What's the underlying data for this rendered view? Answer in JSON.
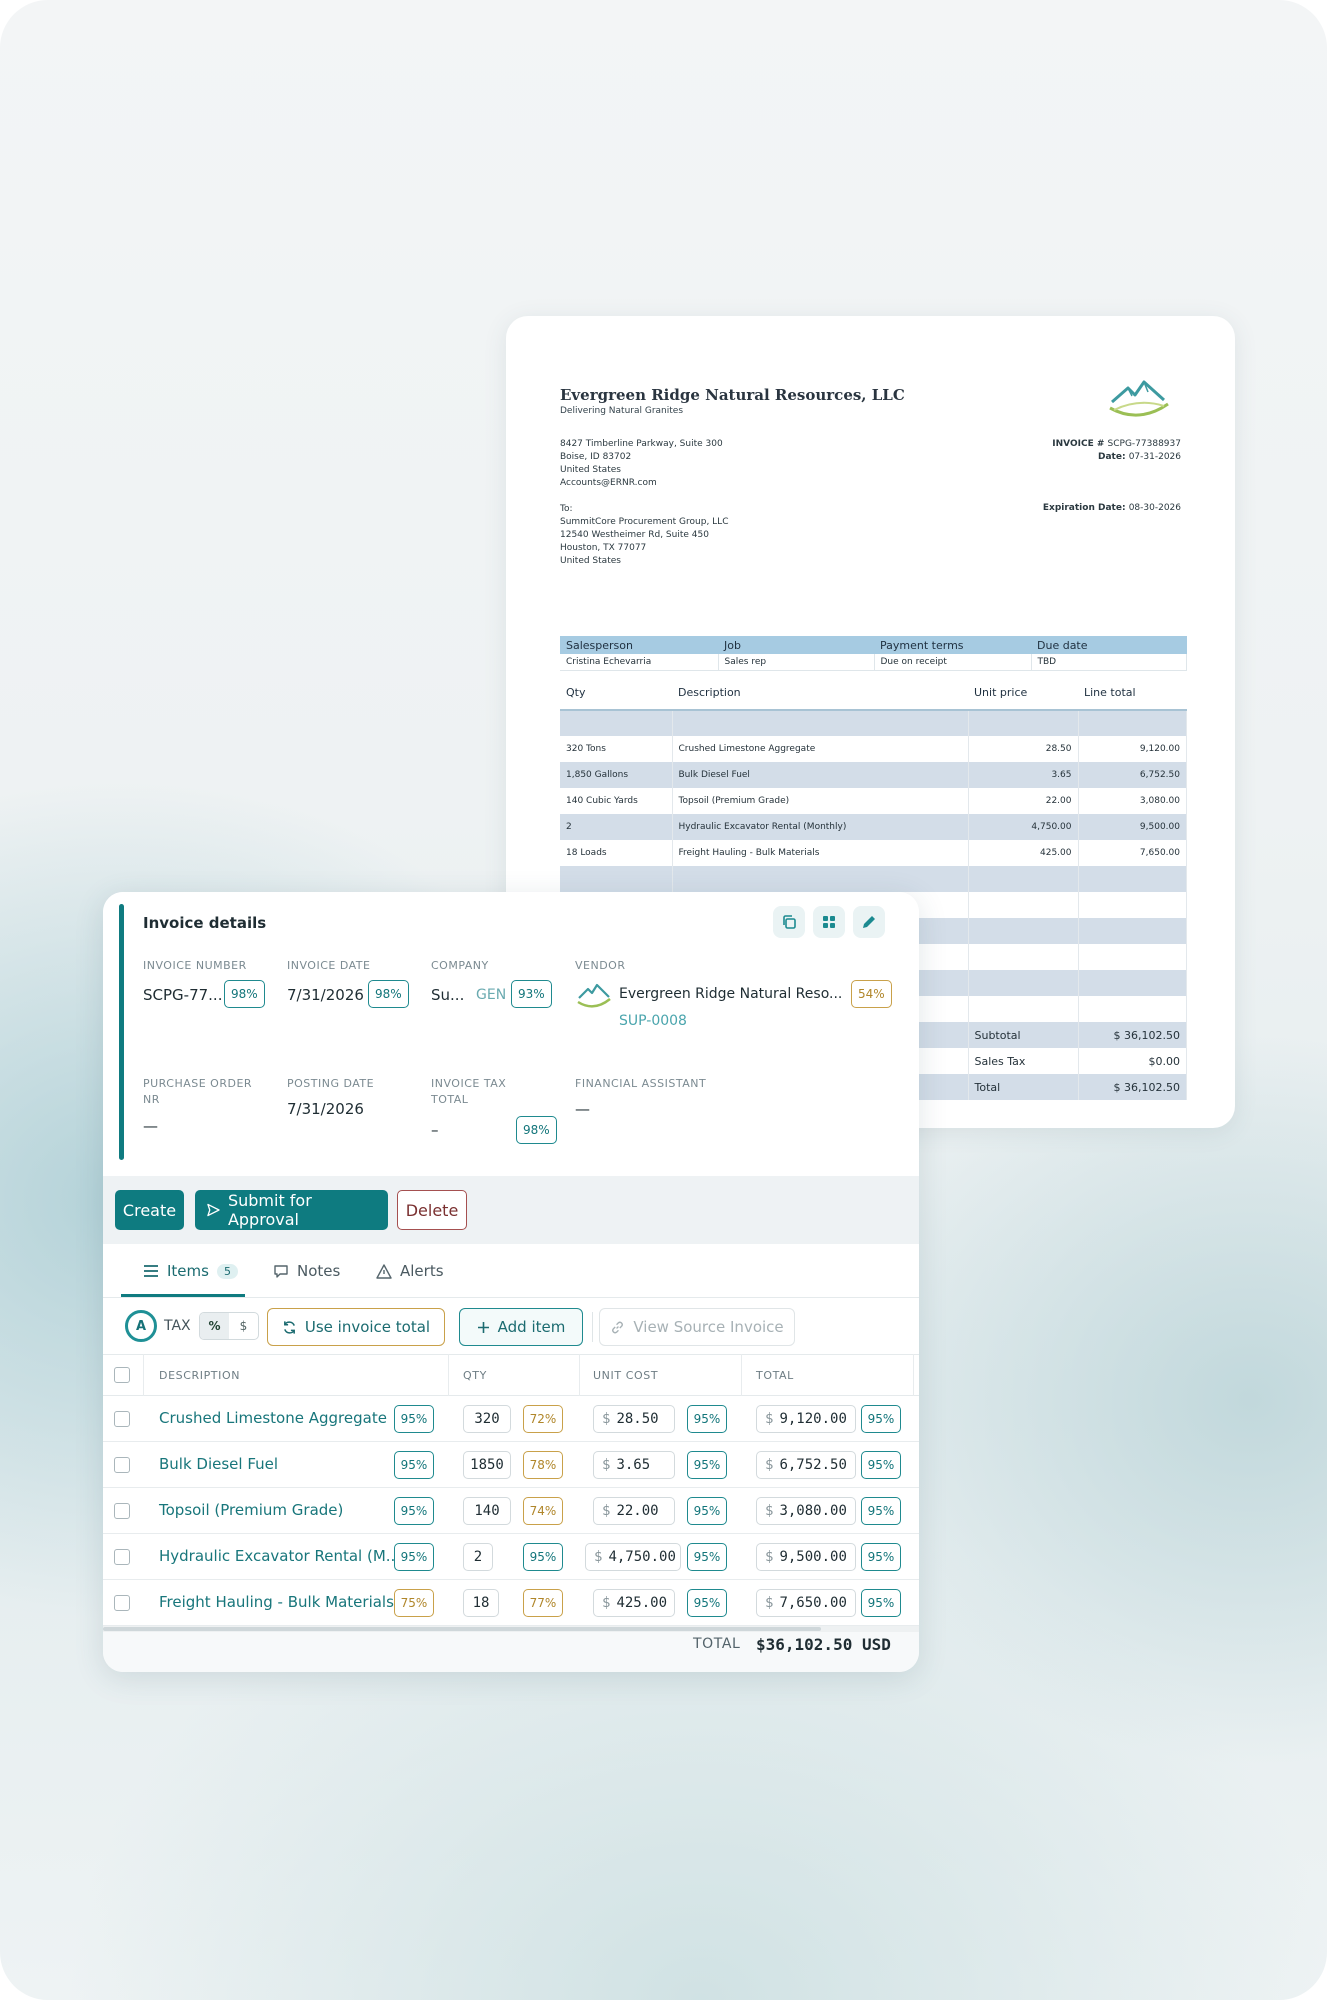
{
  "document": {
    "company_name": "Evergreen Ridge Natural Resources, LLC",
    "tagline": "Delivering Natural Granites",
    "address_lines": [
      "8427 Timberline Parkway, Suite 300",
      "Boise, ID 83702",
      "United States",
      "Accounts@ERNR.com"
    ],
    "invoice_number_label": "INVOICE # ",
    "invoice_number": "SCPG-77388937",
    "date_label": "Date: ",
    "date": "07-31-2026",
    "to_lines": [
      "To:",
      "SummitCore Procurement Group, LLC",
      "12540 Westheimer Rd, Suite 450",
      "Houston, TX 77077",
      "United States"
    ],
    "expiration_label": "Expiration Date: ",
    "expiration_date": "08-30-2026",
    "sales_headers": [
      "Salesperson",
      "Job",
      "Payment terms",
      "Due date"
    ],
    "sales_values": [
      "Cristina Echevarria",
      "Sales rep",
      "Due on receipt",
      "TBD"
    ],
    "line_headers": [
      "Qty",
      "Description",
      "Unit price",
      "Line total"
    ],
    "lines": [
      {
        "qty": "320 Tons",
        "desc": "Crushed Limestone Aggregate",
        "price": "28.50",
        "total": "9,120.00"
      },
      {
        "qty": "1,850 Gallons",
        "desc": "Bulk Diesel Fuel",
        "price": "3.65",
        "total": "6,752.50"
      },
      {
        "qty": "140 Cubic Yards",
        "desc": "Topsoil (Premium Grade)",
        "price": "22.00",
        "total": "3,080.00"
      },
      {
        "qty": "2",
        "desc": "Hydraulic Excavator Rental (Monthly)",
        "price": "4,750.00",
        "total": "9,500.00"
      },
      {
        "qty": "18 Loads",
        "desc": "Freight Hauling - Bulk Materials",
        "price": "425.00",
        "total": "7,650.00"
      }
    ],
    "subtotal_label": "Subtotal",
    "subtotal": "$ 36,102.50",
    "tax_label": "Sales Tax",
    "tax": "$0.00",
    "total_label": "Total",
    "total": "$ 36,102.50",
    "brand_color": "#4a9fa5"
  },
  "details": {
    "title": "Invoice details",
    "invoice_number": {
      "label": "INVOICE NUMBER",
      "value": "SCPG-77...",
      "confidence": "98%"
    },
    "invoice_date": {
      "label": "INVOICE DATE",
      "value": "7/31/2026",
      "confidence": "98%"
    },
    "company": {
      "label": "COMPANY",
      "value": "Su...",
      "code": "GEN",
      "confidence": "93%"
    },
    "vendor": {
      "label": "VENDOR",
      "value": "Evergreen Ridge Natural Reso...",
      "id": "SUP-0008",
      "confidence": "54%"
    },
    "purchase_order": {
      "label_1": "PURCHASE ORDER",
      "label_2": "NR",
      "value": "—"
    },
    "posting_date": {
      "label": "POSTING DATE",
      "value": "7/31/2026"
    },
    "tax_total": {
      "label_1": "INVOICE TAX",
      "label_2": "TOTAL",
      "value": "–",
      "confidence": "98%"
    },
    "financial_assistant": {
      "label": "FINANCIAL ASSISTANT",
      "value": "—"
    }
  },
  "actions": {
    "create": "Create",
    "submit": "Submit for Approval",
    "delete": "Delete"
  },
  "tabs": [
    {
      "label": "Items",
      "count": "5"
    },
    {
      "label": "Notes"
    },
    {
      "label": "Alerts"
    }
  ],
  "toolbar": {
    "tax_circle": "A",
    "tax_label": "TAX",
    "seg_percent": "%",
    "seg_dollar": "$",
    "use_invoice_total": "Use invoice total",
    "add_item": "Add item",
    "view_source": "View Source Invoice"
  },
  "grid": {
    "headers": [
      "DESCRIPTION",
      "QTY",
      "UNIT COST",
      "TOTAL"
    ],
    "currency": "$",
    "rows": [
      {
        "desc": "Crushed Limestone Aggregate",
        "desc_conf": "95%",
        "qty": "320",
        "qty_conf": "72%",
        "unit": "28.50",
        "unit_conf": "95%",
        "total": "9,120.00",
        "total_conf": "95%"
      },
      {
        "desc": "Bulk Diesel Fuel",
        "desc_conf": "95%",
        "qty": "1850",
        "qty_conf": "78%",
        "unit": "3.65",
        "unit_conf": "95%",
        "total": "6,752.50",
        "total_conf": "95%"
      },
      {
        "desc": "Topsoil (Premium Grade)",
        "desc_conf": "95%",
        "qty": "140",
        "qty_conf": "74%",
        "unit": "22.00",
        "unit_conf": "95%",
        "total": "3,080.00",
        "total_conf": "95%"
      },
      {
        "desc": "Hydraulic Excavator Rental (M...",
        "desc_conf": "95%",
        "qty": "2",
        "qty_conf": "95%",
        "unit": "4,750.00",
        "unit_conf": "95%",
        "total": "9,500.00",
        "total_conf": "95%"
      },
      {
        "desc": "Freight Hauling - Bulk Materials",
        "desc_conf": "75%",
        "qty": "18",
        "qty_conf": "77%",
        "unit": "425.00",
        "unit_conf": "95%",
        "total": "7,650.00",
        "total_conf": "95%"
      }
    ],
    "total_label": "TOTAL",
    "total_value": "$36,102.50 USD"
  },
  "colors": {
    "accent": "#0e7b80",
    "confidence_good": "#1f8a8f",
    "confidence_warn": "#c9a14a",
    "danger": "#a55050"
  }
}
